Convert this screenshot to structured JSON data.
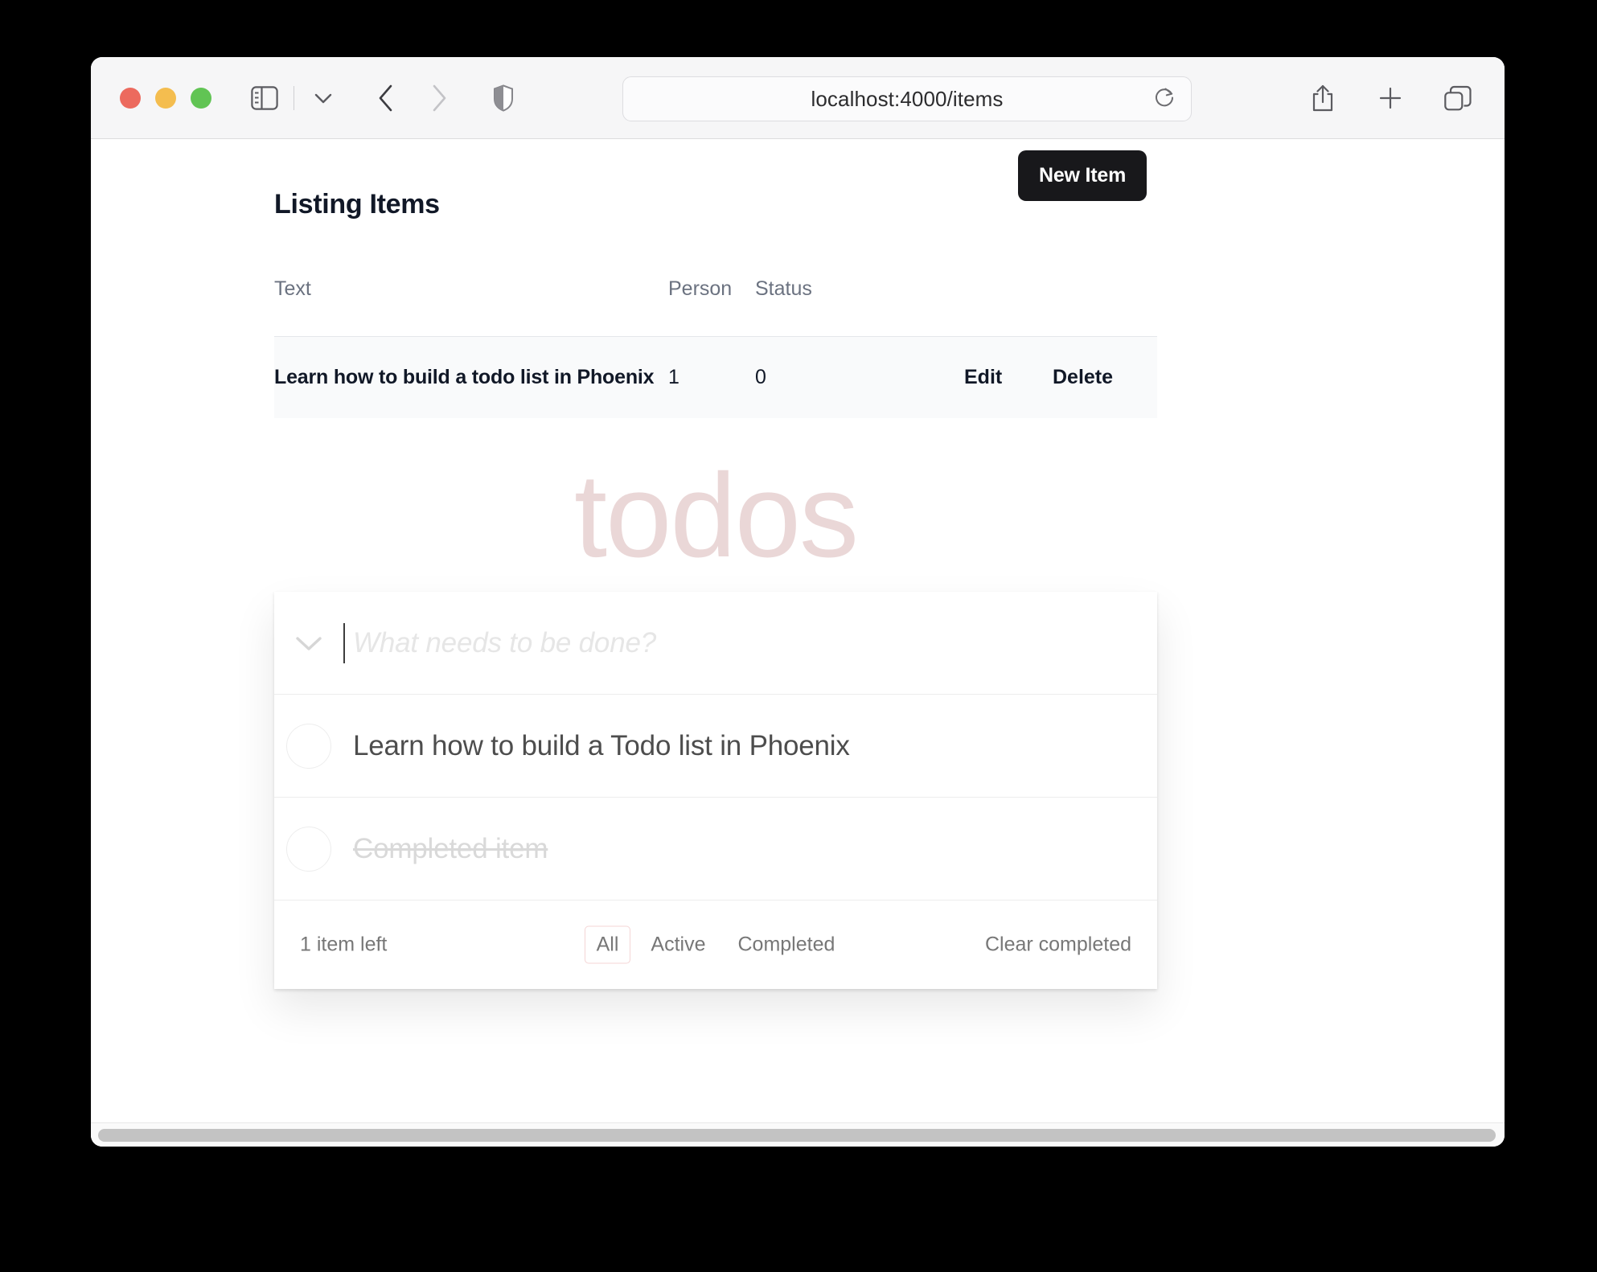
{
  "browser": {
    "url": "localhost:4000/items",
    "traffic_lights": [
      {
        "name": "close-button",
        "color": "#ec6a5e"
      },
      {
        "name": "minimize-button",
        "color": "#f4bd4f"
      },
      {
        "name": "maximize-button",
        "color": "#61c454"
      }
    ],
    "toolbar_icons": {
      "sidebar": "sidebar-toggle-icon",
      "sidebar_chevron": "chevron-down-icon",
      "back": "back-arrow-icon",
      "forward": "forward-arrow-icon",
      "shield": "privacy-shield-icon",
      "reload": "reload-icon",
      "share": "share-icon",
      "new_tab": "plus-icon",
      "tab_overview": "tab-overview-icon"
    }
  },
  "page": {
    "title": "Listing Items",
    "new_item_label": "New Item"
  },
  "table": {
    "headers": [
      "Text",
      "Person",
      "Status"
    ],
    "rows": [
      {
        "text": "Learn how to build a todo list in Phoenix",
        "person": "1",
        "status": "0",
        "edit_label": "Edit",
        "delete_label": "Delete"
      }
    ]
  },
  "todoapp": {
    "title": "todos",
    "new_todo_placeholder": "What needs to be done?",
    "items": [
      {
        "label": "Learn how to build a Todo list in Phoenix",
        "completed": false
      },
      {
        "label": "Completed item",
        "completed": true
      }
    ],
    "footer": {
      "count_text": "1 item left",
      "filters": [
        {
          "label": "All",
          "selected": true
        },
        {
          "label": "Active",
          "selected": false
        },
        {
          "label": "Completed",
          "selected": false
        }
      ],
      "clear_completed_label": "Clear completed"
    },
    "accent_color": "#ead7d7",
    "filter_selected_border": "#f4d5d5"
  }
}
